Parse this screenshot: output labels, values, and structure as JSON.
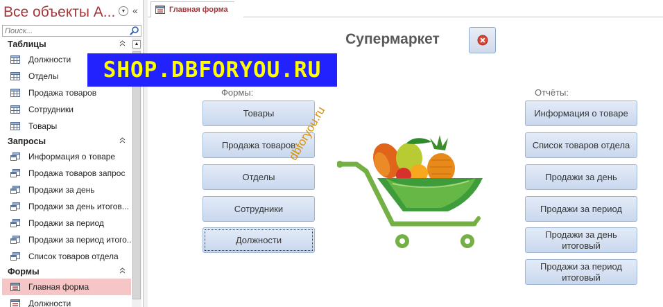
{
  "nav": {
    "title": "Все объекты A...",
    "search_placeholder": "Поиск...",
    "groups": [
      {
        "label": "Таблицы",
        "items": [
          "Должности",
          "Отделы",
          "Продажа товаров",
          "Сотрудники",
          "Товары"
        ]
      },
      {
        "label": "Запросы",
        "items": [
          "Информация о товаре",
          "Продажа товаров запрос",
          "Продажи за день",
          "Продажи за день итогов...",
          "Продажи за период",
          "Продажи за период итого...",
          "Список товаров отдела"
        ]
      },
      {
        "label": "Формы",
        "items": [
          "Главная форма",
          "Должности"
        ]
      }
    ]
  },
  "tab": {
    "label": "Главная форма"
  },
  "form": {
    "title": "Супермаркет",
    "banner": "SHOP.DBFORYOU.RU",
    "watermark": "dbforyou.ru",
    "forms_label": "Формы:",
    "reports_label": "Отчёты:",
    "form_buttons": [
      "Товары",
      "Продажа товаров",
      "Отделы",
      "Сотрудники",
      "Должности"
    ],
    "report_buttons": [
      "Информация о товаре",
      "Список товаров отдела",
      "Продажи за день",
      "Продажи за период",
      "Продажи за день итоговый",
      "Продажи за период итоговый"
    ]
  },
  "colors": {
    "accent": "#a4373a",
    "banner_bg": "#2222ff",
    "banner_text": "#ffff00",
    "button": "#d2dff1",
    "selected": "#f6c5c5",
    "cart_green": "#74b043"
  }
}
